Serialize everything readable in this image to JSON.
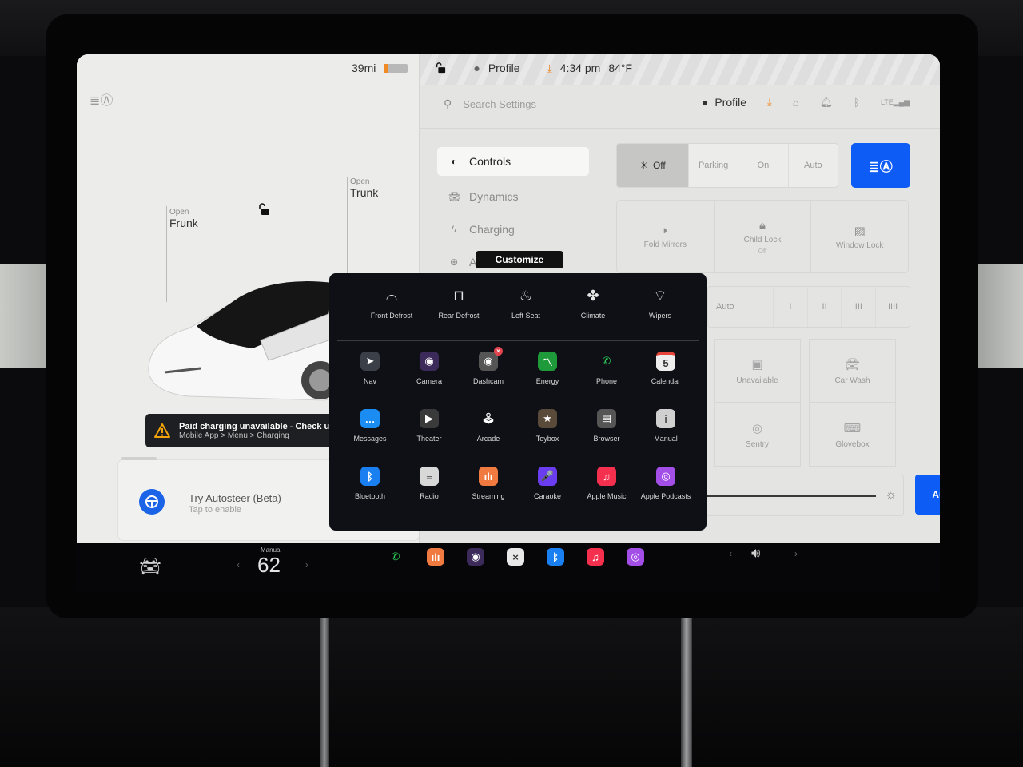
{
  "status_bar": {
    "range": "39mi",
    "battery_percent": 20,
    "profile": "Profile",
    "time": "4:34 pm",
    "temperature": "84°F"
  },
  "car_view": {
    "frunk": {
      "action": "Open",
      "label": "Frunk"
    },
    "trunk": {
      "action": "Open",
      "label": "Trunk"
    },
    "lock_state": "unlocked"
  },
  "alert": {
    "title": "Paid charging unavailable - Check unpaid",
    "subtitle": "Mobile App > Menu > Charging",
    "accent": "#f0a30a"
  },
  "autosteer_card": {
    "title": "Try Autosteer (Beta)",
    "subtitle": "Tap to enable"
  },
  "settings": {
    "search_placeholder": "Search Settings",
    "profile_label": "Profile",
    "nav": [
      {
        "label": "Controls",
        "icon": "toggle-icon",
        "active": true
      },
      {
        "label": "Dynamics",
        "icon": "car-icon",
        "active": false
      },
      {
        "label": "Charging",
        "icon": "bolt-icon",
        "active": false
      },
      {
        "label": "Autopilot",
        "icon": "steering-wheel-icon",
        "active": false
      }
    ],
    "customize_tooltip": "Customize",
    "lights": {
      "options": [
        "Off",
        "Parking",
        "On",
        "Auto"
      ],
      "selected": "Off",
      "auto_high_beam_icon": "auto-high-beam-icon"
    },
    "tiles": [
      {
        "label": "Fold Mirrors",
        "sub": "",
        "icon": "mirror-icon"
      },
      {
        "label": "Child Lock",
        "sub": "Off",
        "icon": "child-lock-icon"
      },
      {
        "label": "Window Lock",
        "sub": "",
        "icon": "window-lock-icon"
      }
    ],
    "wipers": {
      "options": [
        "Auto",
        "I",
        "II",
        "III",
        "IIII"
      ]
    },
    "grid_tiles": [
      {
        "label": "Unavailable",
        "icon": "camera-icon"
      },
      {
        "label": "Car Wash",
        "icon": "car-wash-icon"
      },
      {
        "label": "Sentry",
        "icon": "sentry-icon"
      },
      {
        "label": "Glovebox",
        "icon": "glovebox-icon"
      }
    ],
    "display_brightness_auto": "Auto",
    "accent": "#0c5cf5"
  },
  "launcher": {
    "quick_controls": [
      {
        "label": "Front Defrost",
        "icon": "front-defrost-icon"
      },
      {
        "label": "Rear Defrost",
        "icon": "rear-defrost-icon"
      },
      {
        "label": "Left Seat",
        "icon": "seat-heater-icon"
      },
      {
        "label": "Climate",
        "icon": "fan-icon"
      },
      {
        "label": "Wipers",
        "icon": "wiper-icon"
      }
    ],
    "apps": [
      {
        "label": "Nav",
        "icon": "nav-icon",
        "color": "#3a3f48",
        "glyph": "➤"
      },
      {
        "label": "Camera",
        "icon": "camera-lens-icon",
        "color": "#3b2a5a",
        "glyph": "◉"
      },
      {
        "label": "Dashcam",
        "icon": "dashcam-icon",
        "color": "#555",
        "glyph": "◉",
        "badge": "x"
      },
      {
        "label": "Energy",
        "icon": "energy-icon",
        "color": "#1f9a3a",
        "glyph": "〽"
      },
      {
        "label": "Phone",
        "icon": "phone-icon",
        "color": "transparent",
        "glyph": "✆"
      },
      {
        "label": "Calendar",
        "icon": "calendar-icon",
        "color": "#eeeeee",
        "glyph": "5"
      },
      {
        "label": "Messages",
        "icon": "messages-icon",
        "color": "#1b8cf2",
        "glyph": "…"
      },
      {
        "label": "Theater",
        "icon": "theater-icon",
        "color": "#3a3a3a",
        "glyph": "▶"
      },
      {
        "label": "Arcade",
        "icon": "joystick-icon",
        "color": "transparent",
        "glyph": "🕹"
      },
      {
        "label": "Toybox",
        "icon": "toybox-icon",
        "color": "#5a4a3a",
        "glyph": "★"
      },
      {
        "label": "Browser",
        "icon": "browser-icon",
        "color": "#555",
        "glyph": "▤"
      },
      {
        "label": "Manual",
        "icon": "manual-icon",
        "color": "#d0d0d0",
        "glyph": "i"
      },
      {
        "label": "Bluetooth",
        "icon": "bluetooth-icon",
        "color": "#1a7ff0",
        "glyph": "ᛒ"
      },
      {
        "label": "Radio",
        "icon": "radio-icon",
        "color": "#d8d8d8",
        "glyph": "≡"
      },
      {
        "label": "Streaming",
        "icon": "streaming-icon",
        "color": "#f07a40",
        "glyph": "ılı"
      },
      {
        "label": "Caraoke",
        "icon": "microphone-icon",
        "color": "#6a3df0",
        "glyph": "🎤"
      },
      {
        "label": "Apple Music",
        "icon": "apple-music-icon",
        "color": "#f5304f",
        "glyph": "♫"
      },
      {
        "label": "Apple Podcasts",
        "icon": "apple-podcasts-icon",
        "color": "#a44ee8",
        "glyph": "◎"
      }
    ]
  },
  "dock": {
    "climate_mode": "Manual",
    "cabin_temp": "62",
    "apps": [
      {
        "name": "phone-icon",
        "color": "transparent",
        "glyph": "✆",
        "fg": "#2ed158"
      },
      {
        "name": "streaming-icon",
        "color": "#f07a40",
        "glyph": "ılı",
        "fg": "#fff"
      },
      {
        "name": "camera-lens-icon",
        "color": "#3b2a5a",
        "glyph": "◉",
        "fg": "#fff"
      },
      {
        "name": "close-app-icon",
        "color": "#e8e8e8",
        "glyph": "×",
        "fg": "#333"
      },
      {
        "name": "bluetooth-icon",
        "color": "#1a7ff0",
        "glyph": "ᛒ",
        "fg": "#fff"
      },
      {
        "name": "apple-music-icon",
        "color": "#f5304f",
        "glyph": "♫",
        "fg": "#fff"
      },
      {
        "name": "apple-podcasts-icon",
        "color": "#a44ee8",
        "glyph": "◎",
        "fg": "#fff"
      }
    ]
  }
}
